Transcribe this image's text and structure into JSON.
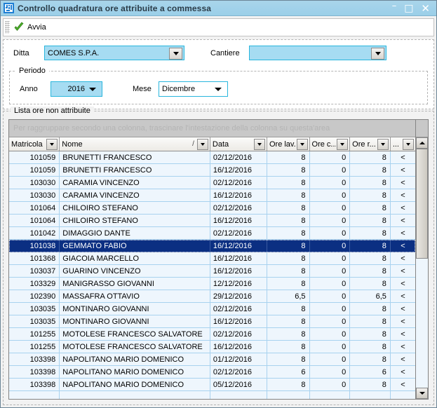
{
  "window": {
    "title": "Controllo quadratura ore attribuite a commessa",
    "icon": "app-maze-icon",
    "controls": {
      "minimize": "–",
      "maximize": "□",
      "close": "✕"
    }
  },
  "toolbar": {
    "avvia_label": "Avvia",
    "avvia_icon": "green-check-icon"
  },
  "form": {
    "ditta_label": "Ditta",
    "ditta_value": "COMES S.P.A.",
    "cantiere_label": "Cantiere",
    "cantiere_value": "",
    "periodo_label": "Periodo",
    "anno_label": "Anno",
    "anno_value": "2016",
    "mese_label": "Mese",
    "mese_value": "Dicembre"
  },
  "list": {
    "group_title": "Lista ore non attribuite",
    "group_band_hint": "Per raggruppare secondo una colonna, trascinare l'intestazione della colonna su questa'area",
    "columns": [
      {
        "label": "Matricola",
        "sort": ""
      },
      {
        "label": "Nome",
        "sort": "/"
      },
      {
        "label": "Data",
        "sort": ""
      },
      {
        "label": "Ore lav.",
        "sort": ""
      },
      {
        "label": "Ore c...",
        "sort": ""
      },
      {
        "label": "Ore r...",
        "sort": ""
      },
      {
        "label": "...",
        "sort": ""
      }
    ],
    "rows": [
      {
        "matricola": "101059",
        "nome": "BRUNETTI FRANCESCO",
        "data": "02/12/2016",
        "ore_lav": "8",
        "ore_c": "0",
        "ore_r": "8",
        "flag": "<",
        "selected": false
      },
      {
        "matricola": "101059",
        "nome": "BRUNETTI FRANCESCO",
        "data": "16/12/2016",
        "ore_lav": "8",
        "ore_c": "0",
        "ore_r": "8",
        "flag": "<",
        "selected": false
      },
      {
        "matricola": "103030",
        "nome": "CARAMIA VINCENZO",
        "data": "02/12/2016",
        "ore_lav": "8",
        "ore_c": "0",
        "ore_r": "8",
        "flag": "<",
        "selected": false
      },
      {
        "matricola": "103030",
        "nome": "CARAMIA VINCENZO",
        "data": "16/12/2016",
        "ore_lav": "8",
        "ore_c": "0",
        "ore_r": "8",
        "flag": "<",
        "selected": false
      },
      {
        "matricola": "101064",
        "nome": "CHILOIRO STEFANO",
        "data": "02/12/2016",
        "ore_lav": "8",
        "ore_c": "0",
        "ore_r": "8",
        "flag": "<",
        "selected": false
      },
      {
        "matricola": "101064",
        "nome": "CHILOIRO STEFANO",
        "data": "16/12/2016",
        "ore_lav": "8",
        "ore_c": "0",
        "ore_r": "8",
        "flag": "<",
        "selected": false
      },
      {
        "matricola": "101042",
        "nome": "DIMAGGIO DANTE",
        "data": "02/12/2016",
        "ore_lav": "8",
        "ore_c": "0",
        "ore_r": "8",
        "flag": "<",
        "selected": false
      },
      {
        "matricola": "101038",
        "nome": "GEMMATO FABIO",
        "data": "16/12/2016",
        "ore_lav": "8",
        "ore_c": "0",
        "ore_r": "8",
        "flag": "<",
        "selected": true
      },
      {
        "matricola": "101368",
        "nome": "GIACOIA MARCELLO",
        "data": "16/12/2016",
        "ore_lav": "8",
        "ore_c": "0",
        "ore_r": "8",
        "flag": "<",
        "selected": false
      },
      {
        "matricola": "103037",
        "nome": "GUARINO VINCENZO",
        "data": "16/12/2016",
        "ore_lav": "8",
        "ore_c": "0",
        "ore_r": "8",
        "flag": "<",
        "selected": false
      },
      {
        "matricola": "103329",
        "nome": "MANIGRASSO GIOVANNI",
        "data": "12/12/2016",
        "ore_lav": "8",
        "ore_c": "0",
        "ore_r": "8",
        "flag": "<",
        "selected": false
      },
      {
        "matricola": "102390",
        "nome": "MASSAFRA OTTAVIO",
        "data": "29/12/2016",
        "ore_lav": "6,5",
        "ore_c": "0",
        "ore_r": "6,5",
        "flag": "<",
        "selected": false
      },
      {
        "matricola": "103035",
        "nome": "MONTINARO GIOVANNI",
        "data": "02/12/2016",
        "ore_lav": "8",
        "ore_c": "0",
        "ore_r": "8",
        "flag": "<",
        "selected": false
      },
      {
        "matricola": "103035",
        "nome": "MONTINARO GIOVANNI",
        "data": "16/12/2016",
        "ore_lav": "8",
        "ore_c": "0",
        "ore_r": "8",
        "flag": "<",
        "selected": false
      },
      {
        "matricola": "101255",
        "nome": "MOTOLESE FRANCESCO SALVATORE",
        "data": "02/12/2016",
        "ore_lav": "8",
        "ore_c": "0",
        "ore_r": "8",
        "flag": "<",
        "selected": false
      },
      {
        "matricola": "101255",
        "nome": "MOTOLESE FRANCESCO SALVATORE",
        "data": "16/12/2016",
        "ore_lav": "8",
        "ore_c": "0",
        "ore_r": "8",
        "flag": "<",
        "selected": false
      },
      {
        "matricola": "103398",
        "nome": "NAPOLITANO MARIO DOMENICO",
        "data": "01/12/2016",
        "ore_lav": "8",
        "ore_c": "0",
        "ore_r": "8",
        "flag": "<",
        "selected": false
      },
      {
        "matricola": "103398",
        "nome": "NAPOLITANO MARIO DOMENICO",
        "data": "02/12/2016",
        "ore_lav": "6",
        "ore_c": "0",
        "ore_r": "6",
        "flag": "<",
        "selected": false
      },
      {
        "matricola": "103398",
        "nome": "NAPOLITANO MARIO DOMENICO",
        "data": "05/12/2016",
        "ore_lav": "8",
        "ore_c": "0",
        "ore_r": "8",
        "flag": "<",
        "selected": false
      }
    ]
  },
  "colors": {
    "titlebar": "#a2d2ea",
    "accent_border": "#29b6dd",
    "combo_fill": "#a6dcf2",
    "row_bg": "#eef6fd",
    "row_line": "#a8d2ef",
    "selection": "#0b2f82"
  }
}
